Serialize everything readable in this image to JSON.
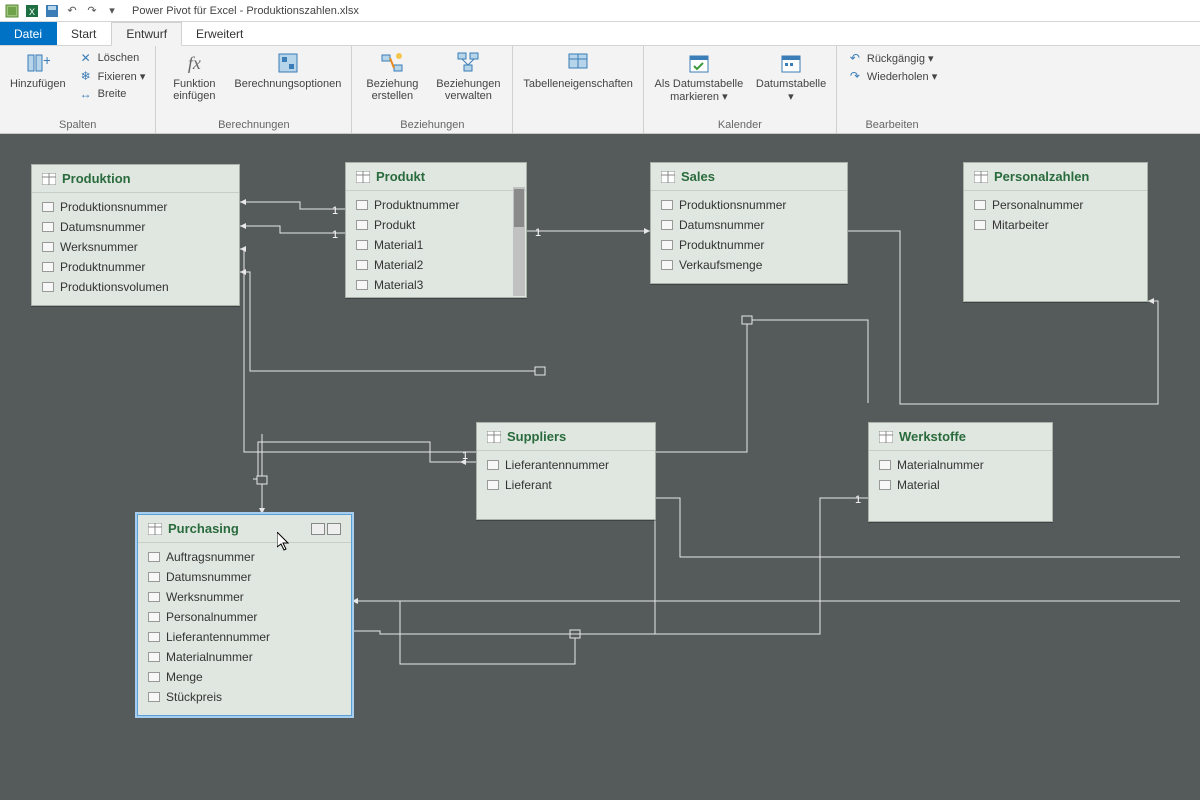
{
  "window": {
    "title": "Power Pivot für Excel - Produktionszahlen.xlsx"
  },
  "tabs": {
    "file": "Datei",
    "t1": "Start",
    "t2": "Entwurf",
    "t3": "Erweitert"
  },
  "ribbon": {
    "spalten": {
      "label": "Spalten",
      "add": "Hinzufügen",
      "del": "Löschen",
      "fix": "Fixieren ▾",
      "width": "Breite"
    },
    "berechnungen": {
      "label": "Berechnungen",
      "fn": "Funktion einfügen",
      "opts": "Berechnungsoptionen"
    },
    "beziehungen": {
      "label": "Beziehungen",
      "create": "Beziehung erstellen",
      "manage": "Beziehungen verwalten"
    },
    "tabellen": {
      "props": "Tabelleneigenschaften"
    },
    "kalender": {
      "label": "Kalender",
      "mark": "Als Datumstabelle markieren ▾",
      "date": "Datumstabelle ▾"
    },
    "bearbeiten": {
      "label": "Bearbeiten",
      "undo": "Rückgängig ▾",
      "redo": "Wiederholen ▾"
    }
  },
  "tables": {
    "produktion": {
      "title": "Produktion",
      "cols": [
        "Produktionsnummer",
        "Datumsnummer",
        "Werksnummer",
        "Produktnummer",
        "Produktionsvolumen"
      ]
    },
    "produkt": {
      "title": "Produkt",
      "cols": [
        "Produktnummer",
        "Produkt",
        "Material1",
        "Material2",
        "Material3"
      ]
    },
    "sales": {
      "title": "Sales",
      "cols": [
        "Produktionsnummer",
        "Datumsnummer",
        "Produktnummer",
        "Verkaufsmenge"
      ]
    },
    "personal": {
      "title": "Personalzahlen",
      "cols": [
        "Personalnummer",
        "Mitarbeiter"
      ]
    },
    "suppliers": {
      "title": "Suppliers",
      "cols": [
        "Lieferantennummer",
        "Lieferant"
      ]
    },
    "werkstoffe": {
      "title": "Werkstoffe",
      "cols": [
        "Materialnummer",
        "Material"
      ]
    },
    "purchasing": {
      "title": "Purchasing",
      "cols": [
        "Auftragsnummer",
        "Datumsnummer",
        "Werksnummer",
        "Personalnummer",
        "Lieferantennummer",
        "Materialnummer",
        "Menge",
        "Stückpreis"
      ]
    }
  },
  "card": {
    "one": "1"
  }
}
